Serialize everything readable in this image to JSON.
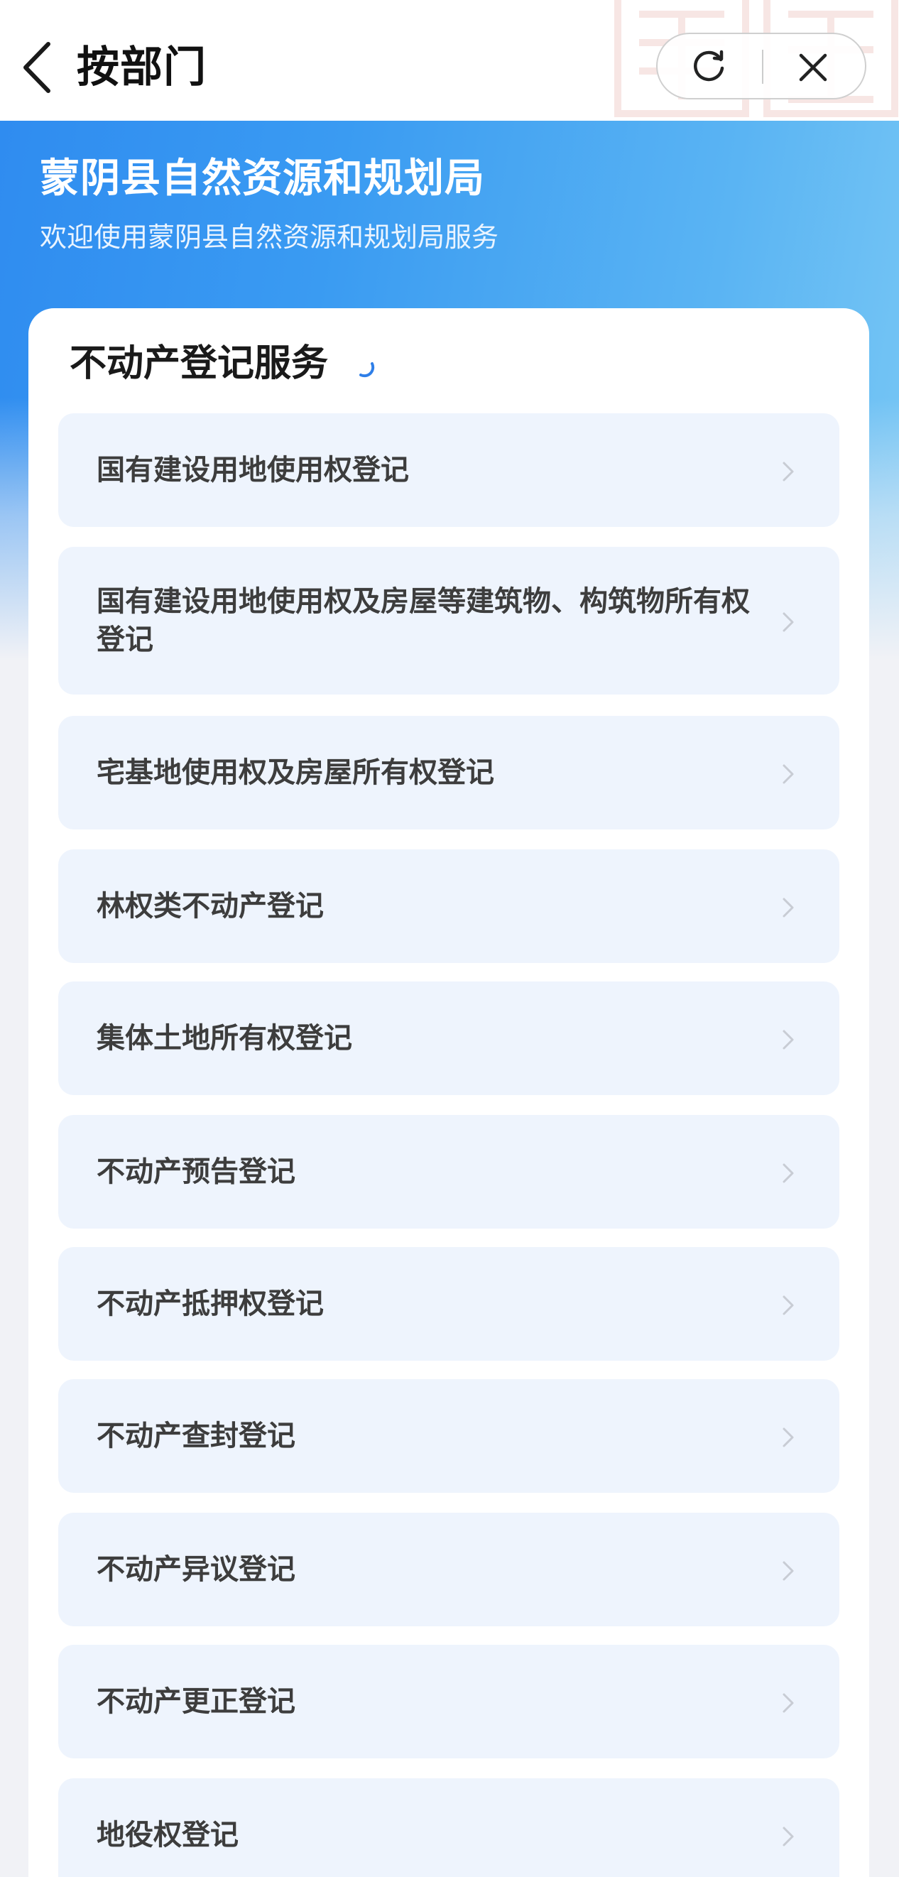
{
  "nav": {
    "title": "按部门"
  },
  "banner": {
    "org_name": "蒙阴县自然资源和规划局",
    "welcome": "欢迎使用蒙阴县自然资源和规划局服务"
  },
  "section": {
    "title": "不动产登记服务",
    "items": [
      {
        "label": "国有建设用地使用权登记"
      },
      {
        "label": "国有建设用地使用权及房屋等建筑物、构筑物所有权登记"
      },
      {
        "label": "宅基地使用权及房屋所有权登记"
      },
      {
        "label": "林权类不动产登记"
      },
      {
        "label": "集体土地所有权登记"
      },
      {
        "label": "不动产预告登记"
      },
      {
        "label": "不动产抵押权登记"
      },
      {
        "label": "不动产查封登记"
      },
      {
        "label": "不动产异议登记"
      },
      {
        "label": "不动产更正登记"
      },
      {
        "label": "地役权登记"
      }
    ]
  },
  "colors": {
    "banner_blue": "#2f8cf0",
    "item_bg": "#eef4fd",
    "page_bg": "#f1f2f6"
  },
  "icons": {
    "back": "chevron-left-icon",
    "refresh": "refresh-icon",
    "close": "close-icon",
    "item_arrow": "chevron-right-icon",
    "loading": "loading-spinner-icon"
  }
}
